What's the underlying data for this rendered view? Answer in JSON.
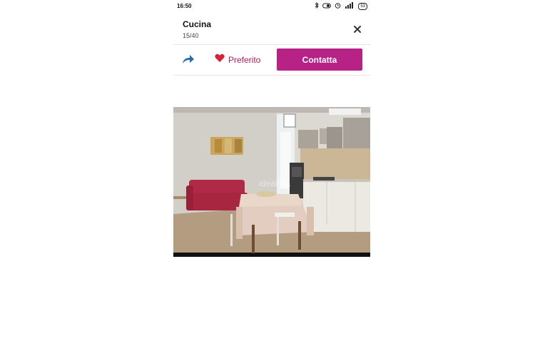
{
  "status_bar": {
    "time": "16:50",
    "battery": "53"
  },
  "header": {
    "title": "Cucina",
    "counter": "15/40"
  },
  "actions": {
    "favorite_label": "Preferito",
    "contact_label": "Contatta"
  },
  "photo": {
    "watermark": "idealista"
  },
  "colors": {
    "accent": "#b72287",
    "heart": "#d6233a",
    "share": "#1f6fb2"
  },
  "icons": [
    "bluetooth-icon",
    "vibrate-icon",
    "alarm-icon",
    "signal-icon",
    "battery-icon",
    "close-icon",
    "share-icon",
    "heart-icon"
  ]
}
